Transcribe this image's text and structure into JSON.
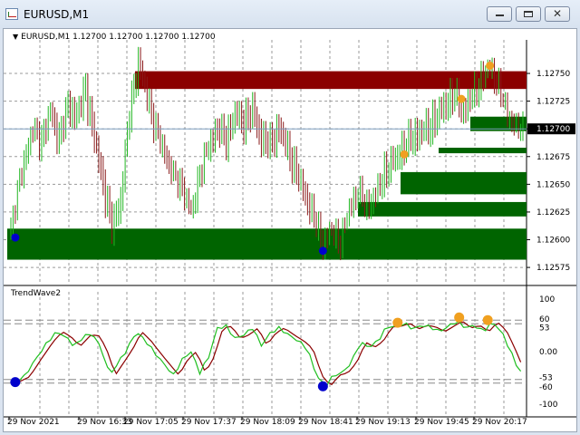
{
  "window": {
    "title": "EURUSD,M1",
    "buttons": {
      "minimize": "minimize",
      "maximize": "maximize",
      "close": "✕"
    }
  },
  "chart": {
    "symbol_info": "EURUSD,M1  1.12700 1.12700 1.12700 1.12700",
    "current_price": "1.12700",
    "indicator_name": "TrendWave2",
    "colors": {
      "bull_candle": "#22b622",
      "bear_candle": "#8a1a1a",
      "supply_zone": "#8b0000",
      "demand_zone": "#006400",
      "signal_top": "#f0a020",
      "signal_bottom": "#0000cc",
      "wave_fast": "#1fbf1f",
      "wave_slow": "#8b0000"
    }
  },
  "chart_data": {
    "type": "candlestick",
    "price_axis": {
      "range": [
        1.12562,
        1.12777
      ],
      "ticks": [
        "1.12750",
        "1.12725",
        "1.12700",
        "1.12675",
        "1.12650",
        "1.12625",
        "1.12600",
        "1.12575"
      ]
    },
    "oscillator_axis": {
      "range": [
        -100,
        100
      ],
      "ticks": [
        "100",
        "60",
        "53",
        "0.00",
        "-53",
        "-60",
        "-100"
      ]
    },
    "time_axis": {
      "labels": [
        "29 Nov 2021",
        "29 Nov 16:33",
        "29 Nov 17:05",
        "29 Nov 17:37",
        "29 Nov 18:09",
        "29 Nov 18:41",
        "29 Nov 19:13",
        "29 Nov 19:45",
        "29 Nov 20:17"
      ]
    },
    "zones": [
      {
        "kind": "supply",
        "top": 1.12752,
        "bottom": 1.12736
      },
      {
        "kind": "demand",
        "top": 1.12711,
        "bottom": 1.12698
      },
      {
        "kind": "demand",
        "top": 1.12683,
        "bottom": 1.12678
      },
      {
        "kind": "demand",
        "top": 1.12661,
        "bottom": 1.12641
      },
      {
        "kind": "demand",
        "top": 1.12634,
        "bottom": 1.12621
      },
      {
        "kind": "demand",
        "top": 1.1261,
        "bottom": 1.12582
      }
    ],
    "close_path": [
      [
        0,
        1.12612
      ],
      [
        5,
        1.12665
      ],
      [
        10,
        1.127
      ],
      [
        14,
        1.1269
      ],
      [
        18,
        1.12715
      ],
      [
        22,
        1.1269
      ],
      [
        26,
        1.1272
      ],
      [
        30,
        1.1271
      ],
      [
        34,
        1.12735
      ],
      [
        38,
        1.1269
      ],
      [
        42,
        1.1265
      ],
      [
        46,
        1.1261
      ],
      [
        50,
        1.12635
      ],
      [
        54,
        1.12715
      ],
      [
        58,
        1.1276
      ],
      [
        62,
        1.1273
      ],
      [
        66,
        1.127
      ],
      [
        70,
        1.1268
      ],
      [
        74,
        1.1266
      ],
      [
        78,
        1.1265
      ],
      [
        82,
        1.12625
      ],
      [
        86,
        1.1266
      ],
      [
        90,
        1.12685
      ],
      [
        94,
        1.127
      ],
      [
        98,
        1.1269
      ],
      [
        102,
        1.12712
      ],
      [
        106,
        1.12705
      ],
      [
        110,
        1.12715
      ],
      [
        114,
        1.1269
      ],
      [
        118,
        1.12685
      ],
      [
        122,
        1.127
      ],
      [
        126,
        1.1268
      ],
      [
        130,
        1.1266
      ],
      [
        134,
        1.1264
      ],
      [
        138,
        1.1262
      ],
      [
        142,
        1.12598
      ],
      [
        146,
        1.1261
      ],
      [
        150,
        1.126
      ],
      [
        154,
        1.1263
      ],
      [
        158,
        1.12645
      ],
      [
        162,
        1.1263
      ],
      [
        166,
        1.1264
      ],
      [
        170,
        1.1266
      ],
      [
        174,
        1.1267
      ],
      [
        178,
        1.1268
      ],
      [
        182,
        1.1269
      ],
      [
        186,
        1.12695
      ],
      [
        190,
        1.127
      ],
      [
        194,
        1.1271
      ],
      [
        198,
        1.12722
      ],
      [
        202,
        1.1273
      ],
      [
        206,
        1.12715
      ],
      [
        210,
        1.1273
      ],
      [
        214,
        1.12745
      ],
      [
        218,
        1.12757
      ],
      [
        222,
        1.1274
      ],
      [
        226,
        1.12715
      ],
      [
        230,
        1.12703
      ],
      [
        233,
        1.127
      ]
    ],
    "candle_count": 234,
    "signals_price": [
      {
        "bar": 2,
        "price": 1.12602,
        "kind": "bottom"
      },
      {
        "bar": 142,
        "price": 1.1259,
        "kind": "bottom"
      },
      {
        "bar": 179,
        "price": 1.12677,
        "kind": "top"
      },
      {
        "bar": 205,
        "price": 1.12727,
        "kind": "top"
      },
      {
        "bar": 218,
        "price": 1.12757,
        "kind": "top"
      }
    ],
    "oscillator_path": [
      [
        0,
        -60
      ],
      [
        6,
        -48
      ],
      [
        12,
        -10
      ],
      [
        17,
        20
      ],
      [
        21,
        38
      ],
      [
        25,
        28
      ],
      [
        29,
        10
      ],
      [
        34,
        32
      ],
      [
        38,
        30
      ],
      [
        42,
        -5
      ],
      [
        45,
        -45
      ],
      [
        49,
        -20
      ],
      [
        53,
        5
      ],
      [
        57,
        38
      ],
      [
        61,
        22
      ],
      [
        66,
        -5
      ],
      [
        70,
        -25
      ],
      [
        74,
        -45
      ],
      [
        78,
        -15
      ],
      [
        82,
        0
      ],
      [
        86,
        -40
      ],
      [
        90,
        -10
      ],
      [
        94,
        45
      ],
      [
        98,
        48
      ],
      [
        102,
        25
      ],
      [
        106,
        32
      ],
      [
        110,
        45
      ],
      [
        114,
        12
      ],
      [
        118,
        35
      ],
      [
        122,
        45
      ],
      [
        127,
        30
      ],
      [
        131,
        20
      ],
      [
        135,
        5
      ],
      [
        139,
        -45
      ],
      [
        143,
        -65
      ],
      [
        147,
        -45
      ],
      [
        151,
        -40
      ],
      [
        155,
        -20
      ],
      [
        159,
        18
      ],
      [
        163,
        8
      ],
      [
        167,
        20
      ],
      [
        171,
        47
      ],
      [
        175,
        48
      ],
      [
        179,
        54
      ],
      [
        183,
        43
      ],
      [
        187,
        50
      ],
      [
        191,
        47
      ],
      [
        195,
        38
      ],
      [
        199,
        48
      ],
      [
        203,
        58
      ],
      [
        207,
        45
      ],
      [
        211,
        50
      ],
      [
        215,
        38
      ],
      [
        219,
        56
      ],
      [
        223,
        40
      ],
      [
        227,
        5
      ],
      [
        231,
        -35
      ],
      [
        234,
        -42
      ]
    ],
    "signals_oscillator": [
      {
        "bar": 2,
        "value": -58,
        "kind": "bottom"
      },
      {
        "bar": 142,
        "value": -66,
        "kind": "bottom"
      },
      {
        "bar": 176,
        "value": 55,
        "kind": "top"
      },
      {
        "bar": 204,
        "value": 65,
        "kind": "top"
      },
      {
        "bar": 217,
        "value": 60,
        "kind": "top"
      }
    ],
    "levels": [
      60,
      53,
      -53,
      -60
    ]
  }
}
